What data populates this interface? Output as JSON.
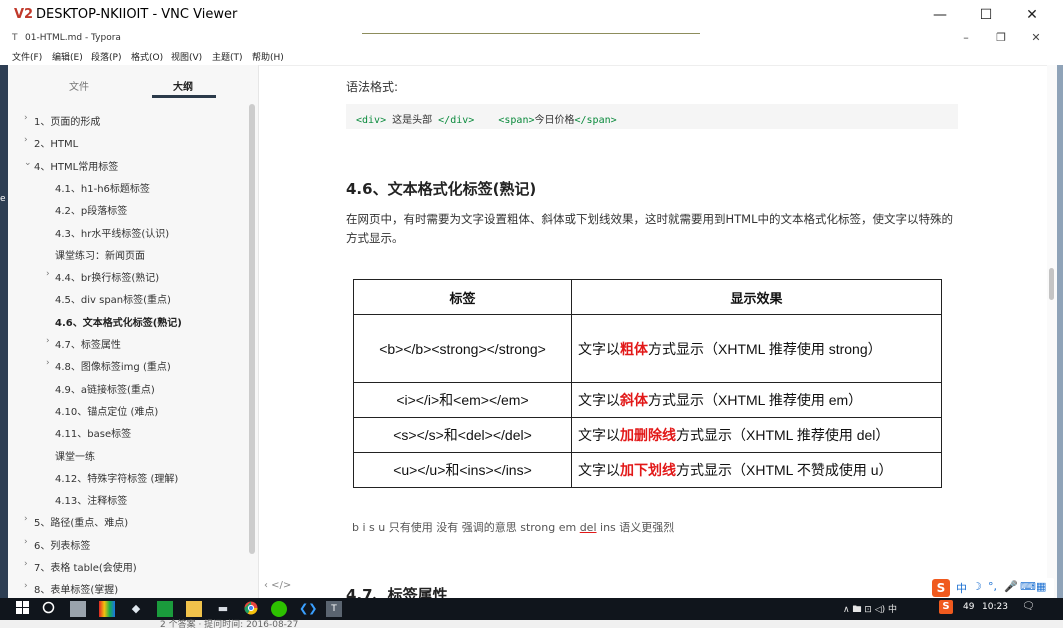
{
  "vnc": {
    "logo": "V2",
    "title": "DESKTOP-NKIIOIT - VNC Viewer",
    "min": "—",
    "max": "☐",
    "close": "✕"
  },
  "typora": {
    "icon": "T",
    "title": "01-HTML.md - Typora",
    "min": "–",
    "restore": "❐",
    "close": "✕"
  },
  "menu": [
    "文件(F)",
    "编辑(E)",
    "段落(P)",
    "格式(O)",
    "视图(V)",
    "主题(T)",
    "帮助(H)"
  ],
  "sidebar": {
    "tab_files": "文件",
    "tab_outline": "大纲",
    "items": [
      {
        "arrow": "›",
        "label": "1、页面的形成"
      },
      {
        "arrow": "›",
        "label": "2、HTML"
      },
      {
        "arrow": "⌄",
        "label": "4、HTML常用标签"
      },
      {
        "arrow": "",
        "label": "4.1、h1-h6标题标签"
      },
      {
        "arrow": "",
        "label": "4.2、p段落标签"
      },
      {
        "arrow": "",
        "label": "4.3、hr水平线标签(认识)"
      },
      {
        "arrow": "",
        "label": "课堂练习：新闻页面"
      },
      {
        "arrow": "›",
        "label": "4.4、br换行标签(熟记)"
      },
      {
        "arrow": "",
        "label": "4.5、div span标签(重点)"
      },
      {
        "arrow": "",
        "label": "4.6、文本格式化标签(熟记)"
      },
      {
        "arrow": "›",
        "label": "4.7、标签属性"
      },
      {
        "arrow": "›",
        "label": "4.8、图像标签img (重点)"
      },
      {
        "arrow": "",
        "label": "4.9、a链接标签(重点)"
      },
      {
        "arrow": "",
        "label": "4.10、锚点定位 (难点)"
      },
      {
        "arrow": "",
        "label": "4.11、base标签"
      },
      {
        "arrow": "",
        "label": "课堂一练"
      },
      {
        "arrow": "",
        "label": "4.12、特殊字符标签 (理解)"
      },
      {
        "arrow": "",
        "label": "4.13、注释标签"
      },
      {
        "arrow": "›",
        "label": "5、路径(重点、难点)"
      },
      {
        "arrow": "›",
        "label": "6、列表标签"
      },
      {
        "arrow": "›",
        "label": "7、表格 table(会使用)"
      },
      {
        "arrow": "›",
        "label": "8、表单标签(掌握)"
      }
    ],
    "bottom_icons": "‹  </>"
  },
  "editor": {
    "syntax_label": "语法格式:",
    "code": {
      "t1": "<div>",
      "x1": " 这是头部 ",
      "t2": "</div>",
      "x2": "    ",
      "t3": "<span>",
      "x3": "今日价格",
      "t4": "</span>"
    },
    "heading": "4.6、文本格式化标签(熟记)",
    "paragraph": "在网页中，有时需要为文字设置粗体、斜体或下划线效果，这时就需要用到HTML中的文本格式化标签，使文字以特殊的方式显示。",
    "table": {
      "headers": [
        "标签",
        "显示效果"
      ],
      "rows": [
        {
          "tag": "<b></b><strong></strong>",
          "pre": "文字以",
          "em": "粗体",
          "post": "方式显示（XHTML 推荐使用 strong）"
        },
        {
          "tag": "<i></i>和<em></em>",
          "pre": "文字以",
          "em": "斜体",
          "post": "方式显示（XHTML 推荐使用 em）"
        },
        {
          "tag": "<s></s>和<del></del>",
          "pre": "文字以",
          "em": "加删除线",
          "post": "方式显示（XHTML 推荐使用 del）"
        },
        {
          "tag": "<u></u>和<ins></ins>",
          "pre": "文字以",
          "em": "加下划线",
          "post": "方式显示（XHTML 不赞成使用 u）"
        }
      ]
    },
    "biu_line": {
      "part1": "b i s u   只有使用 没有 强调的意思      strong   em  ",
      "del": "del",
      "part2": "  ins  语义更强烈"
    },
    "next_heading": "4.7、标签属性"
  },
  "ime": {
    "logo": "S",
    "icons": [
      "中",
      "☽",
      "°,",
      "🎤",
      "⌨",
      "▦"
    ]
  },
  "taskbar": {
    "tray": "∧ 🖿 ⊡ ◁) 中",
    "tray_num": "49",
    "clock": "10:23",
    "notify": "🗨",
    "below_text": "2 个答案 · 提问时间: 2016-08-27",
    "left_e": "e"
  },
  "colors": {
    "accent_red": "#e21818",
    "code_tag": "#0a8a3c",
    "taskbar": "#10151c"
  }
}
